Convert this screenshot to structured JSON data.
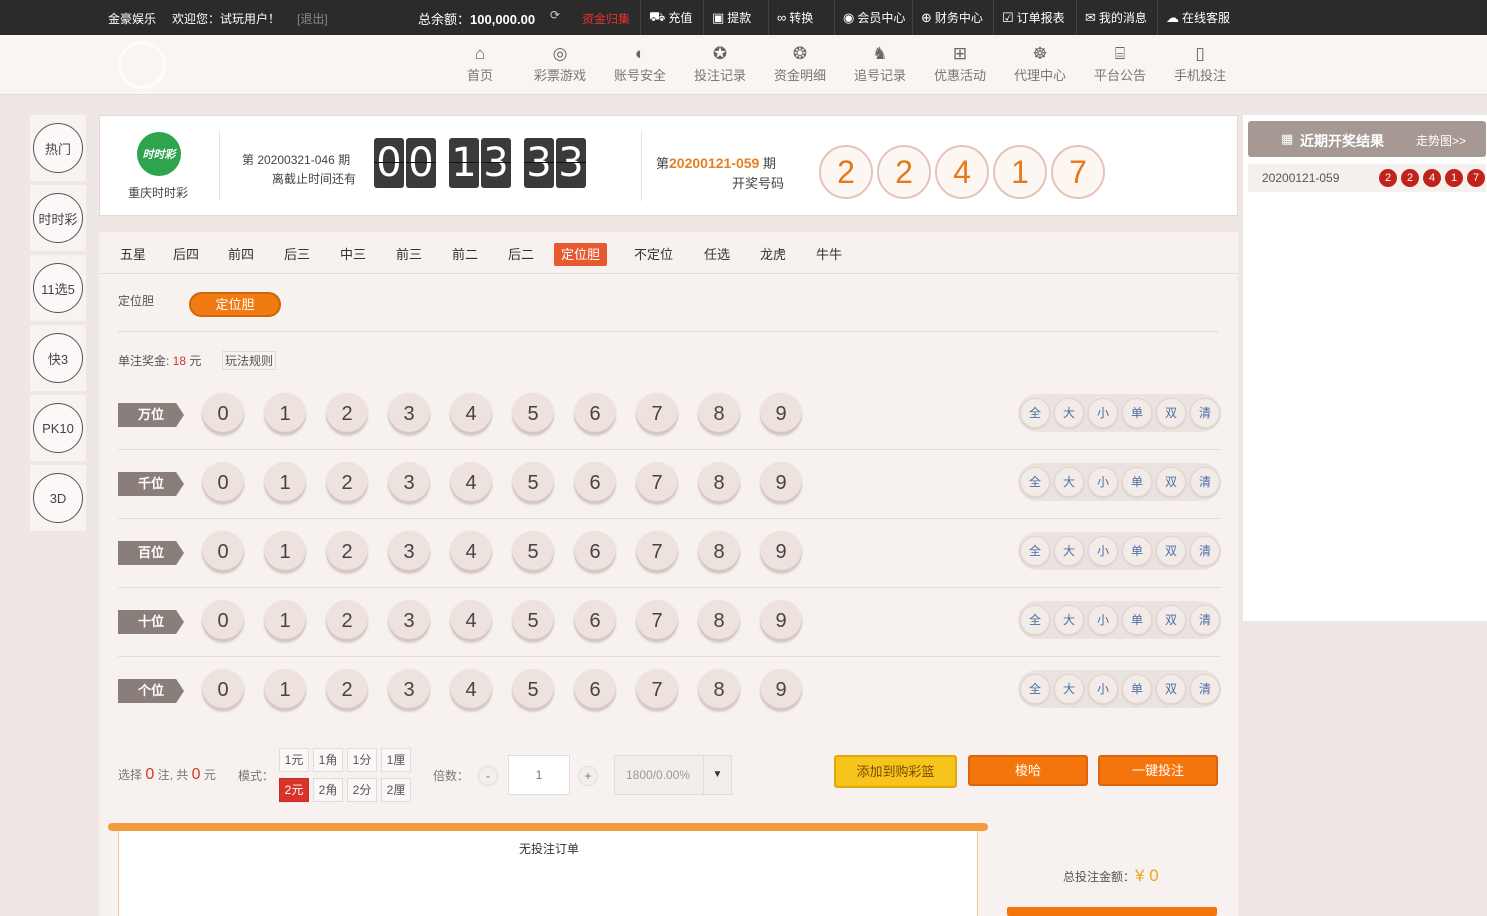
{
  "topbar": {
    "site_name": "金豪娱乐",
    "welcome": "欢迎您：试玩用户！",
    "logout": "[退出]",
    "balance_label": "总余额：",
    "balance_value": "100,000.00",
    "recall": "资金归集",
    "nav": [
      {
        "icon": "gift-box-icon",
        "glyph": "⛟",
        "label": "充值"
      },
      {
        "icon": "wallet-icon",
        "glyph": "▣",
        "label": "提款"
      },
      {
        "icon": "infinity-icon",
        "glyph": "∞",
        "label": "转换"
      },
      {
        "icon": "user-icon",
        "glyph": "◉",
        "label": "会员中心"
      },
      {
        "icon": "finance-icon",
        "glyph": "⊕",
        "label": "财务中心"
      },
      {
        "icon": "report-icon",
        "glyph": "☑",
        "label": "订单报表"
      },
      {
        "icon": "mail-icon",
        "glyph": "✉",
        "label": "我的消息"
      },
      {
        "icon": "chat-icon",
        "glyph": "☁",
        "label": "在线客服"
      }
    ]
  },
  "mainnav": [
    {
      "icon": "home-icon",
      "glyph": "⌂",
      "label": "首页"
    },
    {
      "icon": "lottery-icon",
      "glyph": "◎",
      "label": "彩票游戏"
    },
    {
      "icon": "shield-icon",
      "glyph": "◐",
      "label": "账号安全"
    },
    {
      "icon": "records-icon",
      "glyph": "✪",
      "label": "投注记录"
    },
    {
      "icon": "money-icon",
      "glyph": "❂",
      "label": "资金明细"
    },
    {
      "icon": "chase-icon",
      "glyph": "♞",
      "label": "追号记录"
    },
    {
      "icon": "gift-icon",
      "glyph": "⊞",
      "label": "优惠活动"
    },
    {
      "icon": "agent-icon",
      "glyph": "☸",
      "label": "代理中心"
    },
    {
      "icon": "notice-icon",
      "glyph": "⌸",
      "label": "平台公告"
    },
    {
      "icon": "mobile-icon",
      "glyph": "▯",
      "label": "手机投注"
    }
  ],
  "sidebar": [
    "热门",
    "时时彩",
    "11选5",
    "快3",
    "PK10",
    "3D"
  ],
  "header": {
    "lottery_logo_text": "时时彩",
    "lottery_name": "重庆时时彩",
    "current_issue": "第 20200321-046 期",
    "deadline_label": "离截止时间还有",
    "countdown": [
      "0",
      "0",
      "1",
      "3",
      "3",
      "3"
    ],
    "last_issue_prefix": "第",
    "last_issue_no": "20200121-059",
    "last_issue_suffix": " 期",
    "last_label": "开奖号码",
    "last_numbers": [
      "2",
      "2",
      "4",
      "1",
      "7"
    ]
  },
  "tabs": [
    "五星",
    "后四",
    "前四",
    "后三",
    "中三",
    "前三",
    "前二",
    "后二",
    "定位胆",
    "不定位",
    "任选",
    "龙虎",
    "牛牛"
  ],
  "active_tab": "定位胆",
  "sub_label": "定位胆",
  "sub_button": "定位胆",
  "prize": {
    "label": "单注奖金: ",
    "value": "18",
    "unit": " 元",
    "rules": "玩法规则"
  },
  "rows": [
    "万位",
    "千位",
    "百位",
    "十位",
    "个位"
  ],
  "digits": [
    "0",
    "1",
    "2",
    "3",
    "4",
    "5",
    "6",
    "7",
    "8",
    "9"
  ],
  "quick": [
    "全",
    "大",
    "小",
    "单",
    "双",
    "清"
  ],
  "bottom": {
    "select_pre": "选择",
    "count": "0",
    "select_mid": "注, 共",
    "amount": "0",
    "select_unit": "元",
    "mode_label": "模式：",
    "modes_top": [
      "1元",
      "1角",
      "1分",
      "1厘"
    ],
    "modes_bottom": [
      "2元",
      "2角",
      "2分",
      "2厘"
    ],
    "multiple_label": "倍数：",
    "multiple_value": "1",
    "minus": "-",
    "plus": "+",
    "rebate": "1800/0.00%",
    "add_cart": "添加到购彩篮",
    "shuffle": "梭哈",
    "one_click": "一键投注"
  },
  "orders": {
    "empty": "无投注订单",
    "total_label": "总投注金额：",
    "total_value": "¥ 0"
  },
  "results": {
    "title": "近期开奖结果",
    "trend": "走势图>>",
    "issue": "20200121-059",
    "numbers": [
      "2",
      "2",
      "4",
      "1",
      "7"
    ]
  }
}
